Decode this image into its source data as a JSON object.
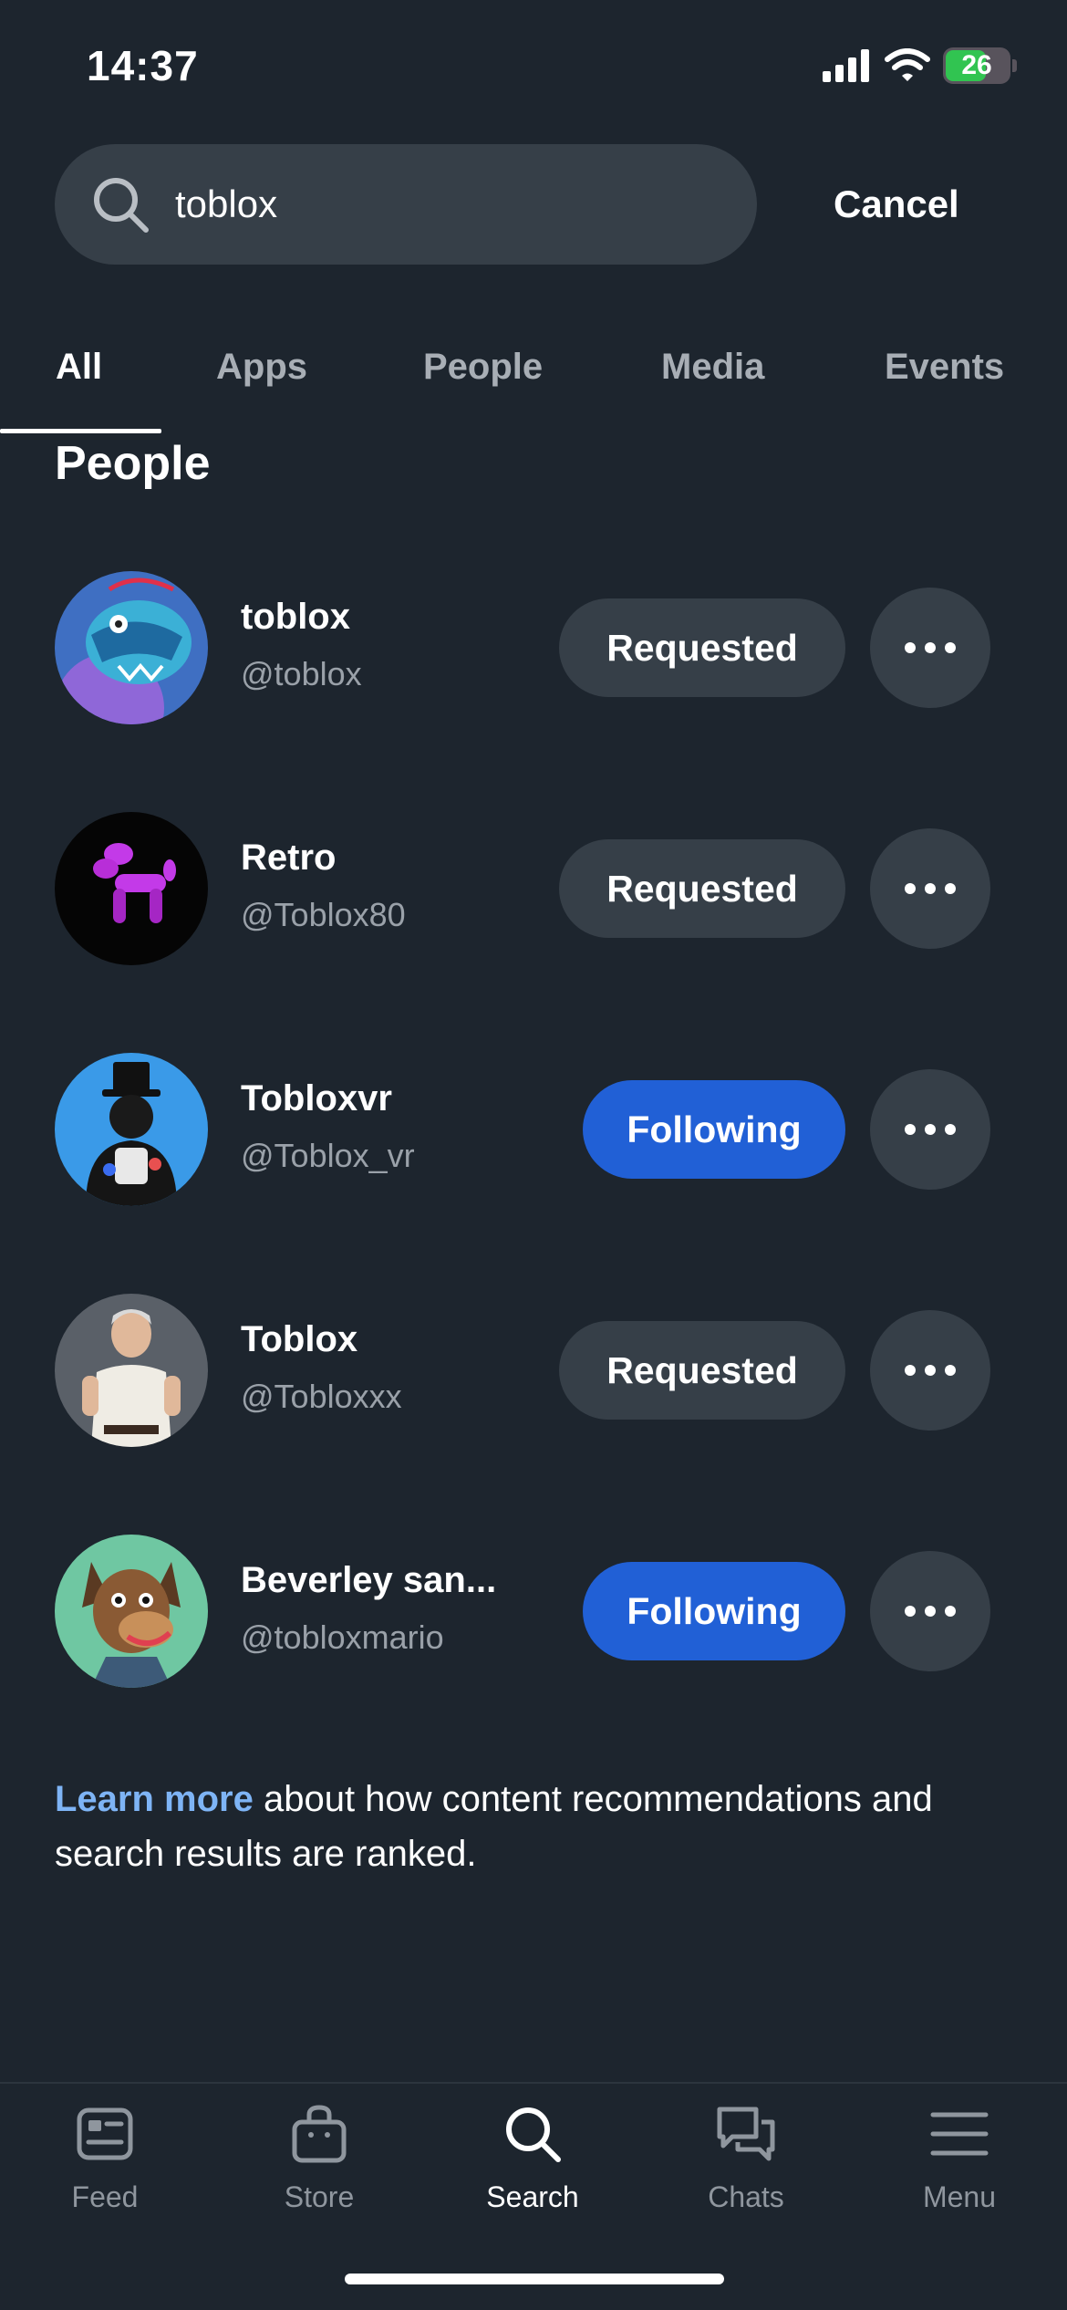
{
  "status_bar": {
    "time": "14:37",
    "battery": "26"
  },
  "search": {
    "query": "toblox",
    "cancel_label": "Cancel"
  },
  "tabs": [
    {
      "label": "All",
      "active": true
    },
    {
      "label": "Apps"
    },
    {
      "label": "People"
    },
    {
      "label": "Media"
    },
    {
      "label": "Events"
    }
  ],
  "section_title": "People",
  "people": [
    {
      "name": "toblox",
      "handle": "@toblox",
      "button": "Requested",
      "state": "requested"
    },
    {
      "name": "Retro",
      "handle": "@Toblox80",
      "button": "Requested",
      "state": "requested"
    },
    {
      "name": "Tobloxvr",
      "handle": "@Toblox_vr",
      "button": "Following",
      "state": "following"
    },
    {
      "name": "Toblox",
      "handle": "@Tobloxxx",
      "button": "Requested",
      "state": "requested"
    },
    {
      "name": "Beverley san...",
      "handle": "@tobloxmario",
      "button": "Following",
      "state": "following"
    }
  ],
  "footnote": {
    "link": "Learn more",
    "text": " about how content recommendations and search results are ranked."
  },
  "bottom_nav": [
    {
      "label": "Feed",
      "icon": "feed-icon"
    },
    {
      "label": "Store",
      "icon": "store-bag-icon"
    },
    {
      "label": "Search",
      "icon": "search-icon",
      "active": true
    },
    {
      "label": "Chats",
      "icon": "chat-bubbles-icon"
    },
    {
      "label": "Menu",
      "icon": "hamburger-menu-icon"
    }
  ],
  "colors": {
    "background": "#1d252e",
    "surface": "#363f48",
    "following_blue": "#2160d6",
    "link_blue": "#7eb4f5",
    "muted_text": "#9aa1a9"
  }
}
